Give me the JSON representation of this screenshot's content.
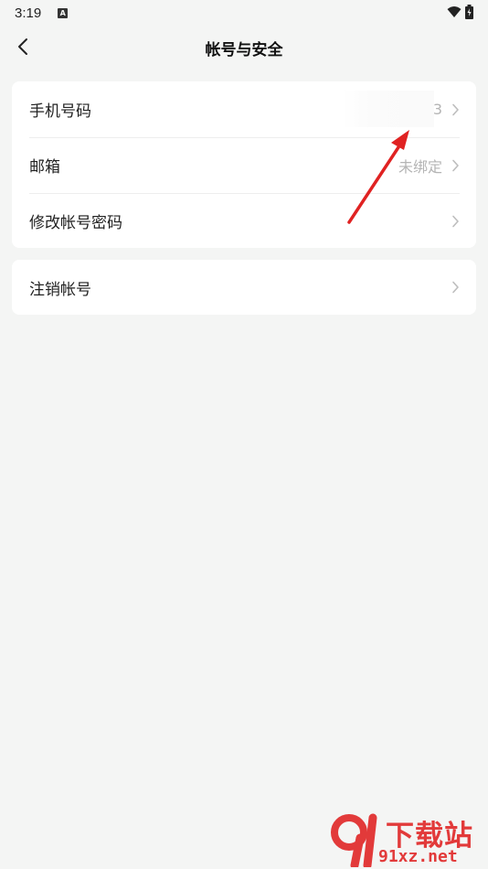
{
  "status_bar": {
    "time": "3:19",
    "notification_icon": "a-icon"
  },
  "header": {
    "title": "帐号与安全",
    "back_icon": "chevron-left-icon"
  },
  "settings": {
    "group1": [
      {
        "label": "手机号码",
        "value": "3"
      },
      {
        "label": "邮箱",
        "value": "未绑定"
      },
      {
        "label": "修改帐号密码",
        "value": ""
      }
    ],
    "group2": [
      {
        "label": "注销帐号",
        "value": ""
      }
    ]
  },
  "colors": {
    "background": "#f4f5f4",
    "card": "#ffffff",
    "value_text": "#b4b4b4",
    "annotation_arrow": "#e02222",
    "watermark": "#e23a3a"
  },
  "watermark": {
    "logo_text": "91",
    "text": "下载站",
    "url": "91xz.net"
  }
}
